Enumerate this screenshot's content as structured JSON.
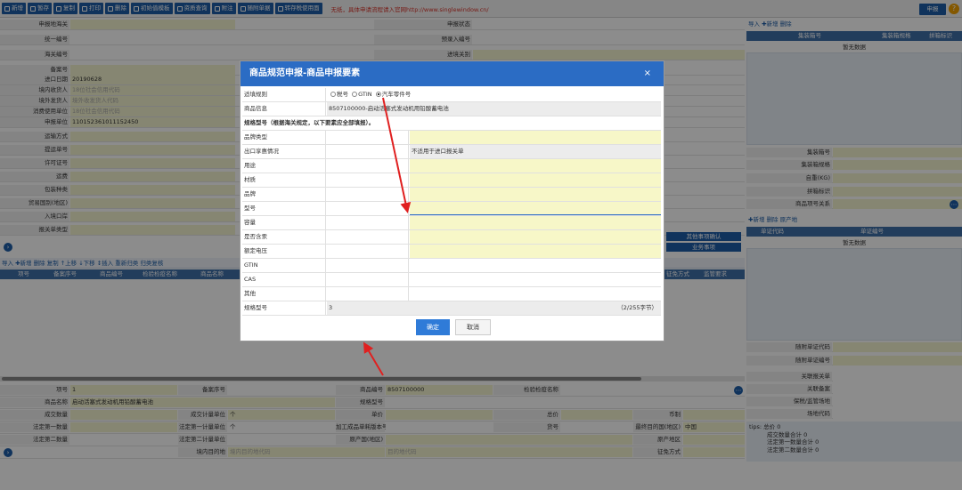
{
  "toolbar": {
    "buttons": [
      "新增",
      "暂存",
      "复制",
      "打印",
      "删除",
      "初始值模板",
      "资质查询",
      "附注",
      "随附单据",
      "转存税使用面"
    ],
    "notice": "无纸，具体申请流程请入官网http://www.singlewindow.cn/",
    "report_label": "申报",
    "help_label": "?"
  },
  "form": {
    "declare_customs_label": "申报地海关",
    "unified_no_label": "统一编号",
    "customs_no_label": "海关编号",
    "record_no_label": "备案号",
    "import_date_label": "进口日期",
    "import_date_value": "20190628",
    "domestic_consignee_label": "境内收货人",
    "domestic_consignee_value": "18位社会信用代码",
    "overseas_shipper_label": "境外发货人",
    "overseas_shipper_value": "境外收发货人代码",
    "consumer_unit_label": "消费使用单位",
    "consumer_unit_value": "18位社会信用代码",
    "declare_unit_label": "申报单位",
    "declare_unit_value": "110152361011152450",
    "transport_mode_label": "运输方式",
    "bill_no_label": "提运单号",
    "license_no_label": "许可证号",
    "freight_label": "运费",
    "package_type_label": "包装种类",
    "trade_country_label": "贸易国别(地区)",
    "entry_port_label": "入境口岸",
    "declare_type_label": "报关单类型",
    "declare_status_label": "申报状态",
    "pre_entry_label": "预录入编号",
    "entry_customs_label": "进境关别"
  },
  "list": {
    "bar": "导入 ✚新增 删除 复制 ↑上移 ↓下移 ↕插入 重新归类 归类复核",
    "columns": [
      "项号",
      "备案序号",
      "商品编号",
      "检验检疫名称",
      "商品名称"
    ],
    "extra_columns": [
      "征免方式",
      "监管要求"
    ],
    "other_btn": "其他事项确认",
    "biz_btn": "业务事项"
  },
  "detail": {
    "item_no_label": "项号",
    "item_no_value": "1",
    "record_seq_label": "备案序号",
    "goods_code_label": "商品编号",
    "goods_code_value": "8507100000",
    "inspection_name_label": "检验检疫名称",
    "goods_name_label": "商品名称",
    "goods_name_value": "启动活塞式发动机用铅酸蓄电池",
    "spec_model_label": "规格型号",
    "deal_qty_label": "成交数量",
    "deal_unit_label": "成交计量单位",
    "deal_unit_value": "个",
    "unit_price_label": "单价",
    "total_price_label": "总价",
    "currency_label": "币制",
    "legal_qty1_label": "法定第一数量",
    "legal_unit1_label": "法定第一计量单位",
    "legal_unit1_value": "个",
    "processing_ver_label": "加工成品单耗版本号",
    "goods_no_label": "货号",
    "final_dest_label": "最终目的国(地区)",
    "final_dest_value": "中国",
    "legal_qty2_label": "法定第二数量",
    "legal_unit2_label": "法定第二计量单位",
    "origin_label": "原产国(地区)",
    "origin_region_label": "原产地区",
    "domestic_dest_label": "境内目的地",
    "domestic_dest_value": "境内目的地代码",
    "dest_code_value": "目的地代码",
    "tax_mode_label": "征免方式"
  },
  "right_panel": {
    "container_bar": "导入 ✚新增 删除",
    "container_cols": [
      "集装箱号",
      "集装箱规格",
      "拼箱标识"
    ],
    "no_data": "暂无数据",
    "container_no_label": "集装箱号",
    "container_spec_label": "集装箱规格",
    "weight_label": "自重(KG)",
    "lcl_label": "拼箱标识",
    "goods_relation_label": "商品项号关系",
    "cert_bar": "✚新增 删除 原产地",
    "cert_cols": [
      "单证代码",
      "单证编号"
    ],
    "attached_code_label": "随附单证代码",
    "attached_no_label": "随附单证编号",
    "related_declare_label": "关联报关单",
    "related_record_label": "关联备案",
    "bonded_label": "保税/监管场地",
    "site_code_label": "场地代码",
    "tips": [
      "tips: 总价 0",
      "成交数量合计 0",
      "法定第一数量合计 0",
      "法定第二数量合计 0"
    ]
  },
  "modal": {
    "title": "商品规范申报-商品申报要素",
    "close": "×",
    "rule_label": "适填规则",
    "rule_options": [
      "税号",
      "GTIN",
      "汽车零件号"
    ],
    "goods_info_label": "商品信息",
    "goods_info_value": "8507100000-启动活塞式发动机用铅酸蓄电池",
    "section_title": "规格型号（根据海关规定，以下要素应全部填报）。",
    "brand_type_label": "品牌类型",
    "export_label": "出口享惠情况",
    "export_value": "不适用于进口报关单",
    "usage_label": "用途",
    "material_label": "材质",
    "brand_label": "品牌",
    "model_label": "型号",
    "capacity_label": "容量",
    "mercury_label": "是否含汞",
    "voltage_label": "额定电压",
    "gtin_label": "GTIN",
    "cas_label": "CAS",
    "other_label": "其他",
    "spec_label": "规格型号",
    "spec_value": "3",
    "spec_counter": "（2/255字节）",
    "ok_label": "确定",
    "cancel_label": "取消"
  }
}
